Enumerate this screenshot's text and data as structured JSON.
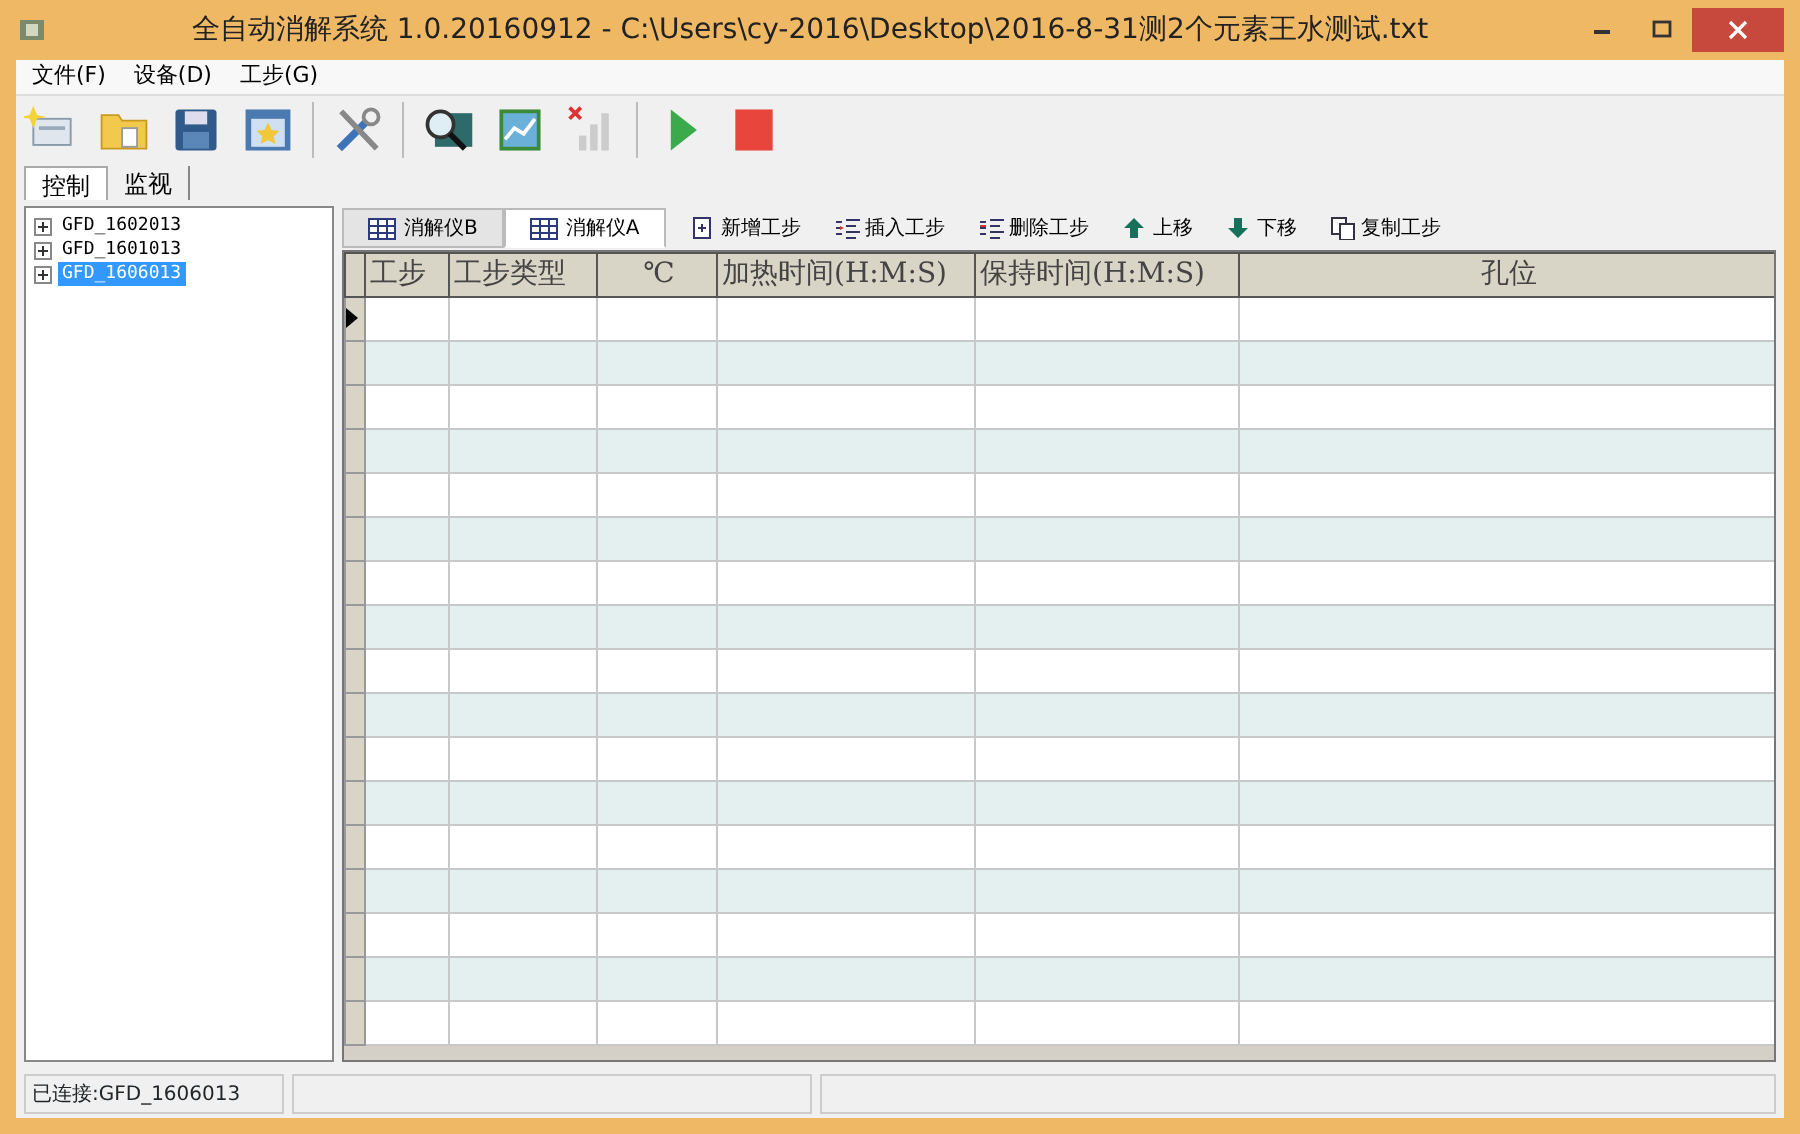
{
  "window": {
    "title": "全自动消解系统 1.0.20160912 - C:\\Users\\cy-2016\\Desktop\\2016-8-31测2个元素王水测试.txt"
  },
  "menu": [
    "文件(F)",
    "设备(D)",
    "工步(G)"
  ],
  "tabs": [
    {
      "label": "控制",
      "selected": true
    },
    {
      "label": "监视",
      "selected": false
    }
  ],
  "tree": [
    {
      "label": "GFD_1602013",
      "selected": false
    },
    {
      "label": "GFD_1601013",
      "selected": false
    },
    {
      "label": "GFD_1606013",
      "selected": true
    }
  ],
  "device_tabs": [
    {
      "label": "消解仪B",
      "selected": false
    },
    {
      "label": "消解仪A",
      "selected": true
    }
  ],
  "step_actions": [
    {
      "kind": "add",
      "label": "新增工步"
    },
    {
      "kind": "insert",
      "label": "插入工步"
    },
    {
      "kind": "delete",
      "label": "删除工步"
    },
    {
      "kind": "up",
      "label": "上移"
    },
    {
      "kind": "down",
      "label": "下移"
    },
    {
      "kind": "copy",
      "label": "复制工步"
    }
  ],
  "table": {
    "columns": [
      "工步",
      "工步类型",
      "℃",
      "加热时间(H:M:S)",
      "保持时间(H:M:S)",
      "孔位"
    ],
    "rows": [
      {
        "current": true
      },
      {
        "current": false
      },
      {
        "current": false
      },
      {
        "current": false
      },
      {
        "current": false
      },
      {
        "current": false
      },
      {
        "current": false
      },
      {
        "current": false
      },
      {
        "current": false
      },
      {
        "current": false
      },
      {
        "current": false
      },
      {
        "current": false
      },
      {
        "current": false
      },
      {
        "current": false
      },
      {
        "current": false
      },
      {
        "current": false
      },
      {
        "current": false
      }
    ]
  },
  "status_bar": [
    "已连接:GFD_1606013"
  ]
}
